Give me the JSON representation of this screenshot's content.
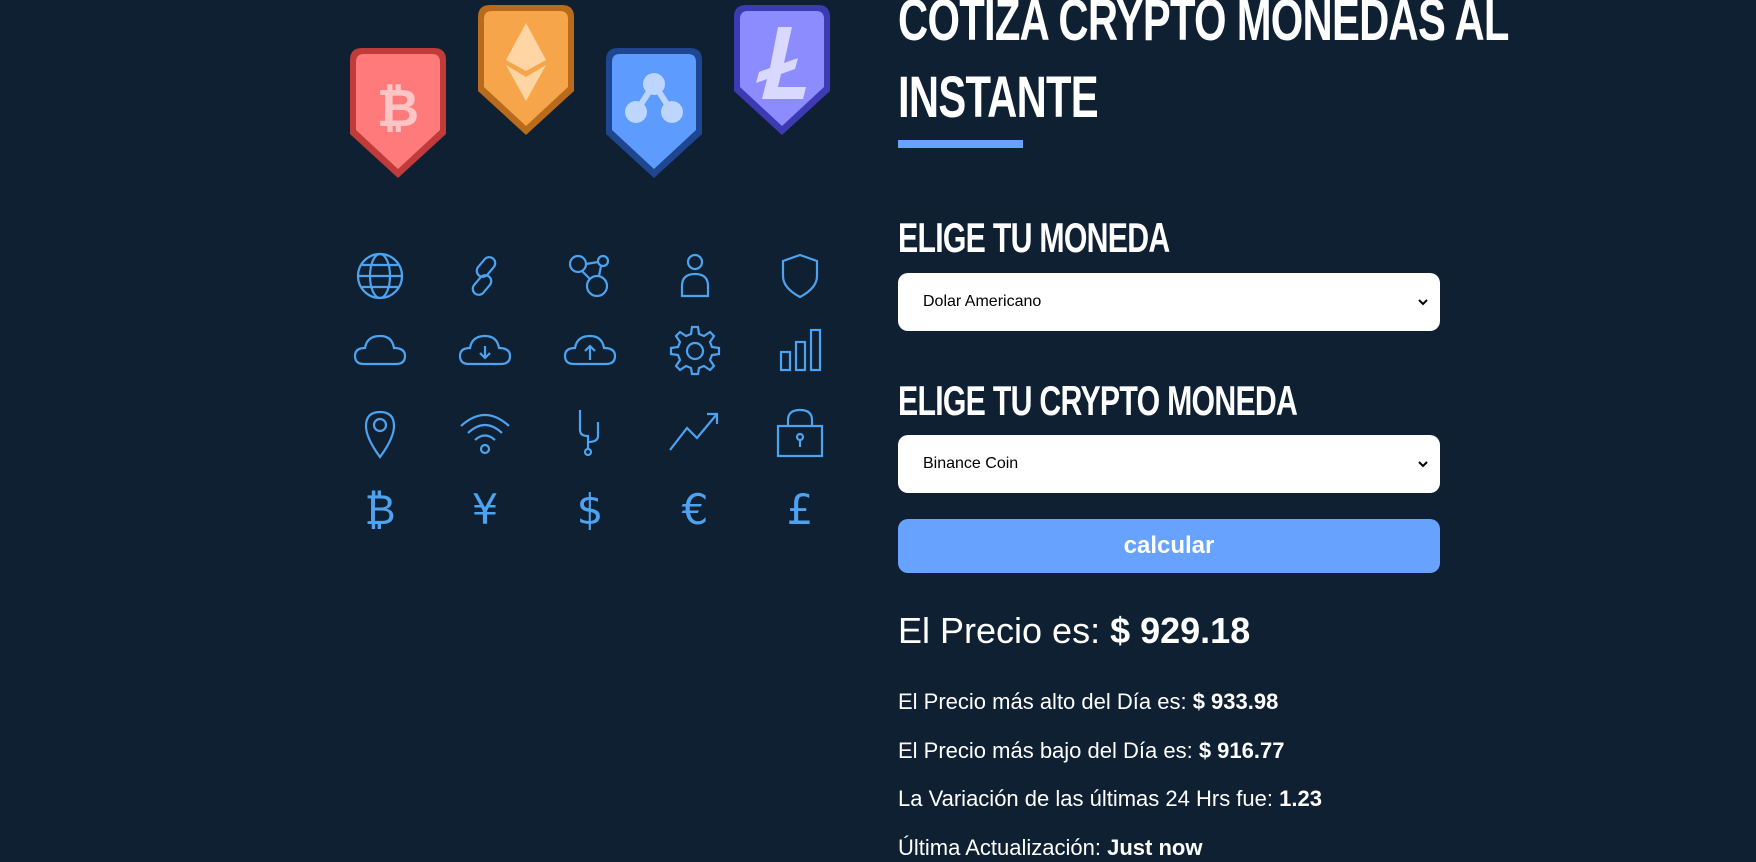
{
  "colors": {
    "background": "#0f2033",
    "accent": "#66a2fe",
    "icon_stroke": "#4da3f0",
    "bitcoin": "#ff7a7a",
    "ethereum": "#f6a54a",
    "ripple": "#5e9bff",
    "litecoin": "#8d8cff"
  },
  "coins": [
    "bitcoin-coin-icon",
    "ethereum-coin-icon",
    "ripple-coin-icon",
    "litecoin-coin-icon"
  ],
  "icons": [
    [
      "globe-icon",
      "link-icon",
      "network-nodes-icon",
      "user-icon",
      "shield-icon"
    ],
    [
      "cloud-icon",
      "cloud-download-icon",
      "cloud-upload-icon",
      "gear-icon",
      "bar-chart-icon"
    ],
    [
      "location-pin-icon",
      "wifi-icon",
      "fork-icon",
      "trending-up-icon",
      "padlock-icon"
    ],
    [
      "bitcoin-icon",
      "yen-icon",
      "dollar-icon",
      "euro-icon",
      "pound-icon"
    ]
  ],
  "header": {
    "title_line1": "Cotiza Crypto Monedas al",
    "title_line2": "Instante"
  },
  "form": {
    "currency_label": "Elige tu Moneda",
    "currency_value": "Dolar Americano",
    "crypto_label": "Elige tu Crypto Moneda",
    "crypto_value": "Binance Coin",
    "submit_label": "calcular"
  },
  "result": {
    "price_label": "El Precio es: ",
    "price_value": "$ 929.18",
    "high_label": "El Precio más alto del Día es: ",
    "high_value": "$ 933.98",
    "low_label": "El Precio más bajo del Día es: ",
    "low_value": "$ 916.77",
    "change_label": "La Variación de las últimas 24 Hrs fue: ",
    "change_value": "1.23",
    "updated_label": "Última Actualización: ",
    "updated_value": "Just now"
  }
}
